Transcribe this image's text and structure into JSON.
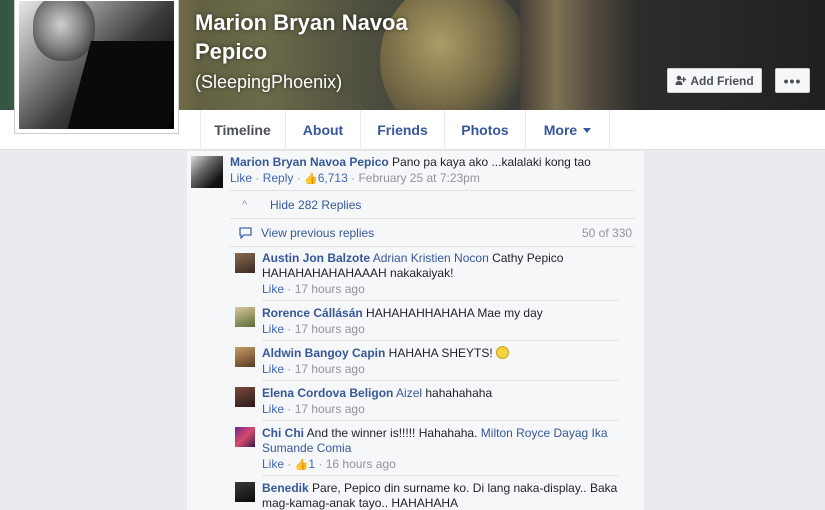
{
  "profile": {
    "name_line1": "Marion Bryan Navoa",
    "name_line2": "Pepico",
    "alias": "(SleepingPhoenix)",
    "add_friend_label": "Add Friend",
    "more_button_label": "•••"
  },
  "nav": {
    "tabs": [
      {
        "label": "Timeline"
      },
      {
        "label": "About"
      },
      {
        "label": "Friends"
      },
      {
        "label": "Photos"
      },
      {
        "label": "More"
      }
    ]
  },
  "post": {
    "author": "Marion Bryan Navoa Pepico",
    "text": " Pano pa kaya ako ...kalalaki kong tao",
    "like": "Like",
    "dot": " · ",
    "reply": "Reply",
    "likes": "6,713",
    "time": "February 25 at 7:23pm"
  },
  "replies": {
    "hide_label": "Hide 282 Replies",
    "view_previous": "View previous replies",
    "count": "50 of 330",
    "items": [
      {
        "author": "Austin Jon Balzote",
        "tag": "Adrian Kristien Nocon",
        "text1": " Cathy Pepico",
        "text2": "HAHAHAHAHAHAAAH nakakaiyak!",
        "like": "Like",
        "time": "17 hours ago"
      },
      {
        "author": "Rorence Cállásán",
        "text": " HAHAHAHHAHAHA Mae my day",
        "like": "Like",
        "time": "17 hours ago"
      },
      {
        "author": "Aldwin Bangoy Capin",
        "text": " HAHAHA SHEYTS! ",
        "like": "Like",
        "time": "17 hours ago"
      },
      {
        "author": "Elena Cordova Beligon",
        "tag": "Aizel",
        "text": " hahahahaha",
        "like": "Like",
        "time": "17 hours ago"
      },
      {
        "author": "Chi Chi",
        "text": " And the winner is!!!!! Hahahaha. ",
        "tag": "Milton Royce Dayag Ika",
        "tag2": "Sumande Comia",
        "like": "Like",
        "likes": "1",
        "time": "16 hours ago"
      },
      {
        "author": "Benedik",
        "text1": " Pare, Pepico din surname ko. Di lang naka-display.. Baka",
        "text2": "mag-kamag-anak tayo.. HAHAHAHA"
      }
    ]
  },
  "colors": {
    "link": "#365899",
    "meta": "#90949c",
    "panel": "#f6f7f9",
    "tab_text": "#4b4f56"
  }
}
